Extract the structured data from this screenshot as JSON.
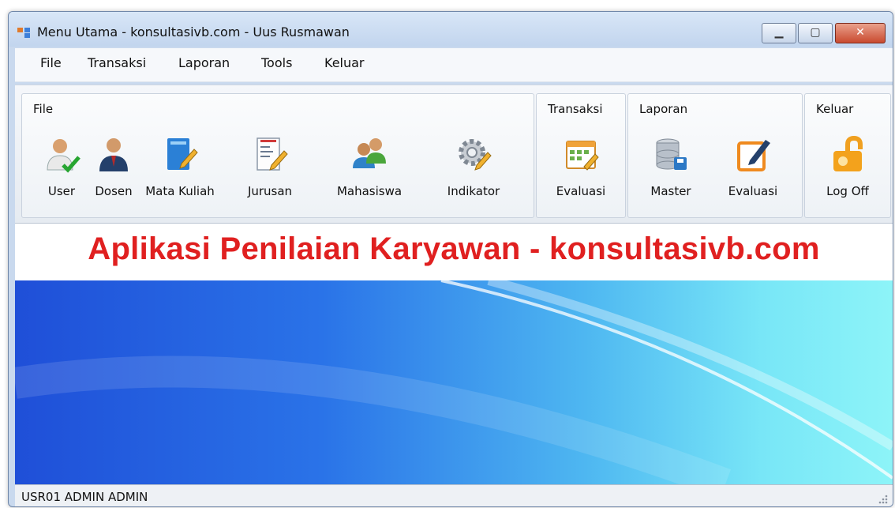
{
  "window": {
    "title": "Menu Utama - konsultasivb.com - Uus Rusmawan"
  },
  "menubar": {
    "items": [
      "File",
      "Transaksi",
      "Laporan",
      "Tools",
      "Keluar"
    ]
  },
  "toolbar": {
    "groups": [
      {
        "label": "File",
        "tools": [
          "User",
          "Dosen",
          "Mata Kuliah",
          "Jurusan",
          "Mahasiswa",
          "Indikator"
        ]
      },
      {
        "label": "Transaksi",
        "tools": [
          "Evaluasi"
        ]
      },
      {
        "label": "Laporan",
        "tools": [
          "Master",
          "Evaluasi"
        ]
      },
      {
        "label": "Keluar",
        "tools": [
          "Log Off"
        ]
      }
    ]
  },
  "banner": {
    "text": "Aplikasi Penilaian Karyawan - konsultasivb.com",
    "color": "#e02020"
  },
  "statusbar": {
    "text": "USR01  ADMIN  ADMIN"
  },
  "icons": {
    "app": "app-icon",
    "minimize": "minimize-icon",
    "maximize": "maximize-icon",
    "close": "close-icon",
    "tools": [
      "user-icon",
      "dosen-icon",
      "book-icon",
      "document-icon",
      "users-icon",
      "gear-icon",
      "calendar-icon",
      "database-icon",
      "edit-icon",
      "lock-icon"
    ]
  }
}
